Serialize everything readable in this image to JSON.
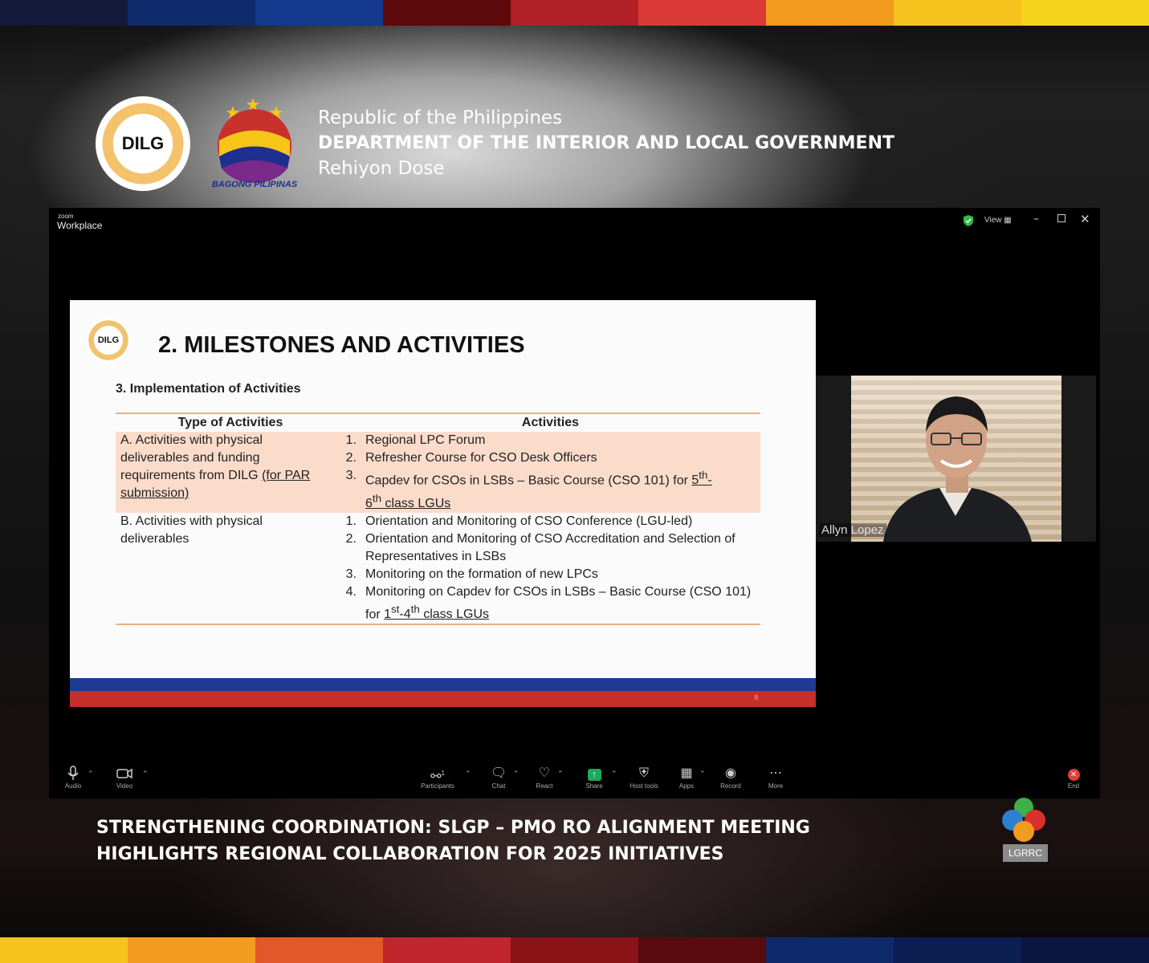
{
  "stripes": {
    "top": [
      "#151a3b",
      "#0f2b6b",
      "#133a8c",
      "#5e0a0c",
      "#b01f25",
      "#d93a36",
      "#f29b1f",
      "#f6c21e",
      "#f5d31c"
    ],
    "bottom": [
      "#f6c21e",
      "#f29b1f",
      "#e2582a",
      "#c0262b",
      "#8b1318",
      "#5a0b0e",
      "#0f2a6b",
      "#0c1e52",
      "#0b1640"
    ]
  },
  "header": {
    "dilg_logo_text": "DILG",
    "bagong_pilipinas_text": "BAGONG PILIPINAS",
    "line1": "Republic of the Philippines",
    "line2": "DEPARTMENT OF THE INTERIOR AND LOCAL GOVERNMENT",
    "line3": "Rehiyon Dose"
  },
  "zoom": {
    "brand_small": "zoom",
    "brand": "Workplace",
    "view_label": "View",
    "icons": {
      "security": "shield-icon",
      "minimize": "minimize-icon",
      "restore": "restore-icon",
      "close": "close-icon"
    }
  },
  "slide": {
    "logo_text": "DILG",
    "title": "2. MILESTONES AND ACTIVITIES",
    "subtitle": "3. Implementation of Activities",
    "headers": {
      "type": "Type of Activities",
      "activities": "Activities"
    },
    "row_a": {
      "type_lines": [
        "A. Activities with physical",
        "deliverables and funding",
        "requirements from DILG",
        "(for PAR",
        "submission)"
      ],
      "items": [
        {
          "num": "1.",
          "text": "Regional LPC Forum"
        },
        {
          "num": "2.",
          "text": "Refresher Course for CSO Desk Officers"
        },
        {
          "num": "3.",
          "text_a": "Capdev for CSOs in LSBs – Basic Course (CSO 101) for ",
          "u1": "5",
          "sup1": "th",
          "u1b": "-",
          "u2": "6",
          "sup2": "th",
          "u2b": " class LGUs"
        }
      ]
    },
    "row_b": {
      "type_lines": [
        "B. Activities with physical",
        "deliverables"
      ],
      "items": [
        {
          "num": "1.",
          "text": "Orientation and Monitoring of CSO Conference (LGU-led)"
        },
        {
          "num": "2.",
          "text": "Orientation and Monitoring of CSO Accreditation and Selection of Representatives in LSBs"
        },
        {
          "num": "3.",
          "text": "Monitoring on the formation of new LPCs"
        },
        {
          "num": "4.",
          "text_a": "Monitoring on Capdev for CSOs in LSBs – Basic Course (CSO 101) for ",
          "u1": "1",
          "sup1": "st",
          "u1b": "-4",
          "sup2": "th",
          "u2b": " class LGUs"
        }
      ]
    },
    "page_number": "6"
  },
  "video": {
    "participant_name": "Allyn Lopez"
  },
  "toolbar": {
    "audio": "Audio",
    "video": "Video",
    "participants": "Participants",
    "participants_count": "1",
    "chat": "Chat",
    "react": "React",
    "share": "Share",
    "host_tools": "Host tools",
    "apps": "Apps",
    "record": "Record",
    "more": "More",
    "end": "End",
    "colors": {
      "share_green": "#1ea85b",
      "end_red": "#e0403a"
    }
  },
  "headline": {
    "line1": "STRENGTHENING COORDINATION: SLGP – PMO RO ALIGNMENT MEETING",
    "line2": "HIGHLIGHTS REGIONAL COLLABORATION FOR 2025 INITIATIVES"
  },
  "lgrrc": {
    "label": "LGRRC"
  }
}
